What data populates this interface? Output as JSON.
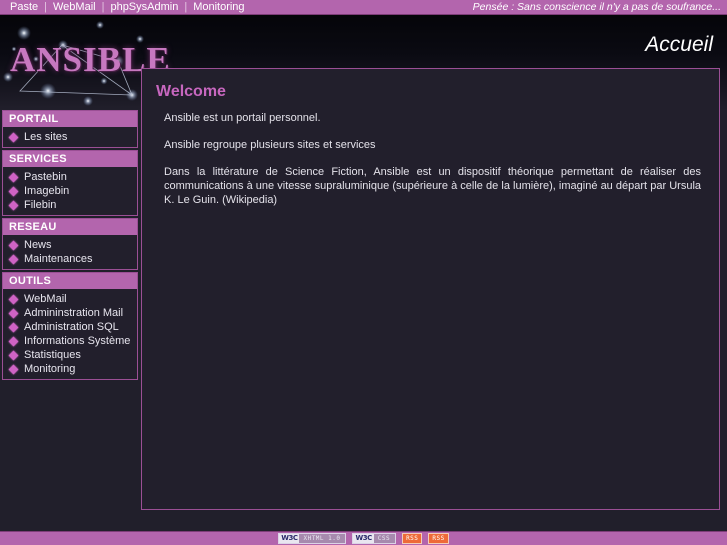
{
  "topbar": {
    "links": [
      "Paste",
      "WebMail",
      "phpSysAdmin",
      "Monitoring"
    ],
    "separator": "|",
    "quote": "Pensée : Sans conscience il n'y a pas de soufrance..."
  },
  "header": {
    "logo_text": "ANSIBLE",
    "page_title": "Accueil"
  },
  "sidebar": {
    "blocks": [
      {
        "title": "PORTAIL",
        "items": [
          {
            "label": "Les sites"
          }
        ]
      },
      {
        "title": "SERVICES",
        "items": [
          {
            "label": "Pastebin"
          },
          {
            "label": "Imagebin"
          },
          {
            "label": "Filebin"
          }
        ]
      },
      {
        "title": "RESEAU",
        "items": [
          {
            "label": "News"
          },
          {
            "label": "Maintenances"
          }
        ]
      },
      {
        "title": "OUTILS",
        "items": [
          {
            "label": "WebMail"
          },
          {
            "label": "Admininstration Mail"
          },
          {
            "label": "Administration SQL"
          },
          {
            "label": "Informations Système"
          },
          {
            "label": "Statistiques"
          },
          {
            "label": "Monitoring"
          }
        ]
      }
    ]
  },
  "content": {
    "title": "Welcome",
    "paragraphs": [
      "Ansible est un portail personnel.",
      "Ansible regroupe plusieurs sites et services",
      "Dans la littérature de Science Fiction, Ansible est un dispositif théorique permettant de réaliser des communications à une vitesse supraluminique (supérieure à celle de la lumière), imaginé au départ par Ursula K. Le Guin. (Wikipedia)"
    ]
  },
  "footer": {
    "badges": [
      {
        "type": "w3c",
        "mark": "W3C",
        "label": "XHTML 1.0"
      },
      {
        "type": "w3c",
        "mark": "W3C",
        "label": "CSS"
      },
      {
        "type": "rss",
        "label": "RSS"
      },
      {
        "type": "rss",
        "label": "RSS"
      }
    ]
  },
  "colors": {
    "accent": "#b365ad",
    "border": "#9b4f95",
    "title": "#c767bf",
    "background": "#211f2b",
    "panel": "#221f2c",
    "rss": "#ee6a38"
  }
}
